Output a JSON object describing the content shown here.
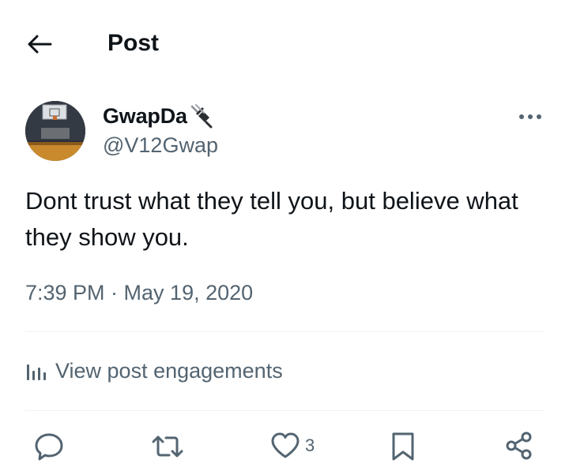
{
  "header": {
    "back_icon": "arrow-left-icon",
    "title": "Post"
  },
  "post": {
    "author": {
      "display_name": "GwapDa",
      "name_emoji": "electric-plug-icon",
      "handle": "@V12Gwap",
      "avatar": "basketball-court-photo"
    },
    "more_icon": "more-horizontal-icon",
    "text": "Dont trust what they tell you, but believe what they show you.",
    "timestamp": "7:39 PM · May 19, 2020"
  },
  "engagements": {
    "icon": "analytics-bars-icon",
    "label": "View post engagements"
  },
  "actions": {
    "reply_icon": "reply-bubble-icon",
    "repost_icon": "repost-icon",
    "like_icon": "heart-icon",
    "like_count": "3",
    "bookmark_icon": "bookmark-icon",
    "share_icon": "share-icon"
  },
  "colors": {
    "text_primary": "#0f1419",
    "text_secondary": "#536471",
    "divider": "#eff3f4"
  }
}
